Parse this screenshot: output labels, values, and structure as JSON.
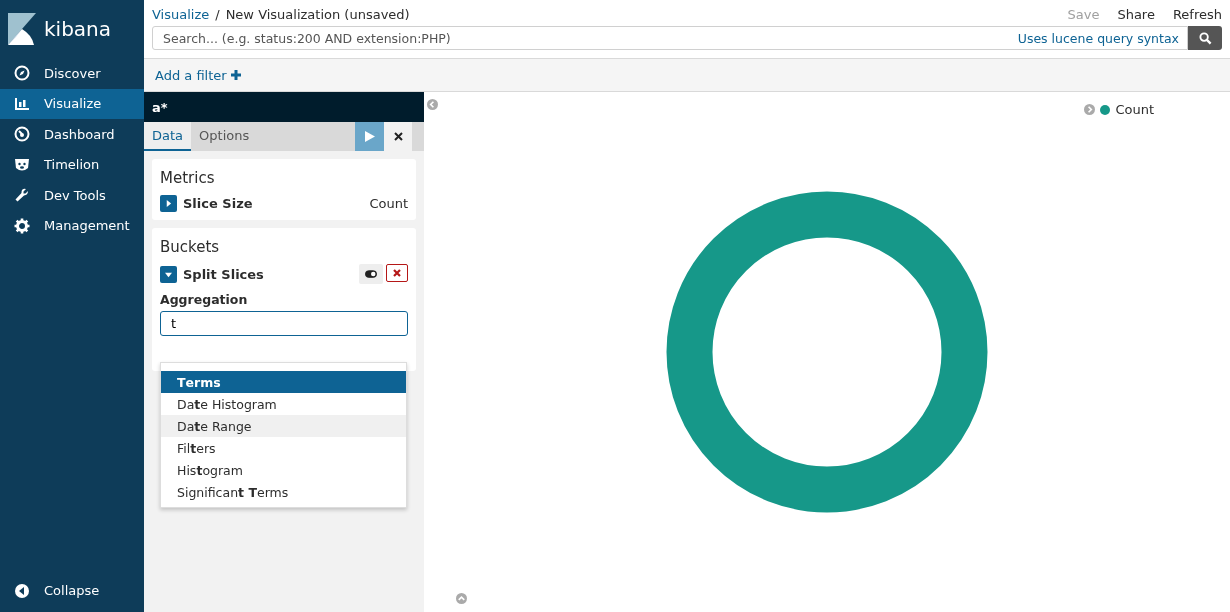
{
  "sidebar": {
    "logo": "kibana",
    "items": [
      {
        "label": "Discover",
        "selected": false
      },
      {
        "label": "Visualize",
        "selected": true
      },
      {
        "label": "Dashboard",
        "selected": false
      },
      {
        "label": "Timelion",
        "selected": false
      },
      {
        "label": "Dev Tools",
        "selected": false
      },
      {
        "label": "Management",
        "selected": false
      }
    ],
    "collapse": "Collapse"
  },
  "breadcrumbs": [
    {
      "label": "Visualize",
      "link": true
    },
    {
      "label": "New Visualization (unsaved)",
      "link": false
    }
  ],
  "separator": "/",
  "top_actions": [
    {
      "label": "Save",
      "disabled": true
    },
    {
      "label": "Share",
      "disabled": false
    },
    {
      "label": "Refresh",
      "disabled": false
    }
  ],
  "search": {
    "placeholder": "Search... (e.g. status:200 AND extension:PHP)",
    "syntax_link": "Uses lucene query syntax"
  },
  "add_filter": "Add a filter",
  "editor": {
    "index": "a*",
    "tabs": [
      {
        "label": "Data",
        "selected": true
      },
      {
        "label": "Options",
        "selected": false
      }
    ],
    "metrics": {
      "title": "Metrics",
      "agg": {
        "label": "Slice Size",
        "value": "Count",
        "expanded": false
      }
    },
    "buckets": {
      "title": "Buckets",
      "agg": {
        "label": "Split Slices",
        "expanded": true,
        "enabled": true
      },
      "field_label": "Aggregation",
      "value": "t",
      "options": [
        {
          "label": "**T**erms",
          "selected": true,
          "hovered": false
        },
        {
          "label": "Da**t**e Histogram",
          "selected": false,
          "hovered": false
        },
        {
          "label": "Da**t**e Range",
          "selected": false,
          "hovered": true
        },
        {
          "label": "Fil**t**ers",
          "selected": false,
          "hovered": false
        },
        {
          "label": "His**t**ogram",
          "selected": false,
          "hovered": false
        },
        {
          "label": "Significan**t T**erms",
          "selected": false,
          "hovered": false
        }
      ]
    }
  },
  "legend": [
    {
      "label": "Count",
      "color": "#169889"
    }
  ]
}
